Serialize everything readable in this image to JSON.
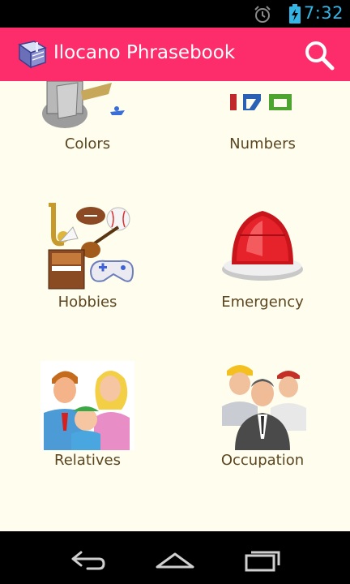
{
  "status_bar": {
    "time": "7:32",
    "icons": [
      "alarm-icon",
      "battery-charging-icon"
    ],
    "accent_color": "#33b5e5"
  },
  "action_bar": {
    "title": "Ilocano Phrasebook",
    "background_color": "#fd2c6a",
    "icons": [
      "phrasebook-book-icon",
      "search-icon"
    ]
  },
  "categories": [
    {
      "label": "Colors",
      "icon": "colors-paint-icon"
    },
    {
      "label": "Numbers",
      "icon": "numbers-icon"
    },
    {
      "label": "Hobbies",
      "icon": "hobbies-icon"
    },
    {
      "label": "Emergency",
      "icon": "emergency-siren-icon"
    },
    {
      "label": "Relatives",
      "icon": "relatives-family-icon"
    },
    {
      "label": "Occupation",
      "icon": "occupation-workers-icon"
    }
  ],
  "nav_bar": {
    "icons": [
      "back-icon",
      "home-icon",
      "recent-apps-icon"
    ]
  }
}
